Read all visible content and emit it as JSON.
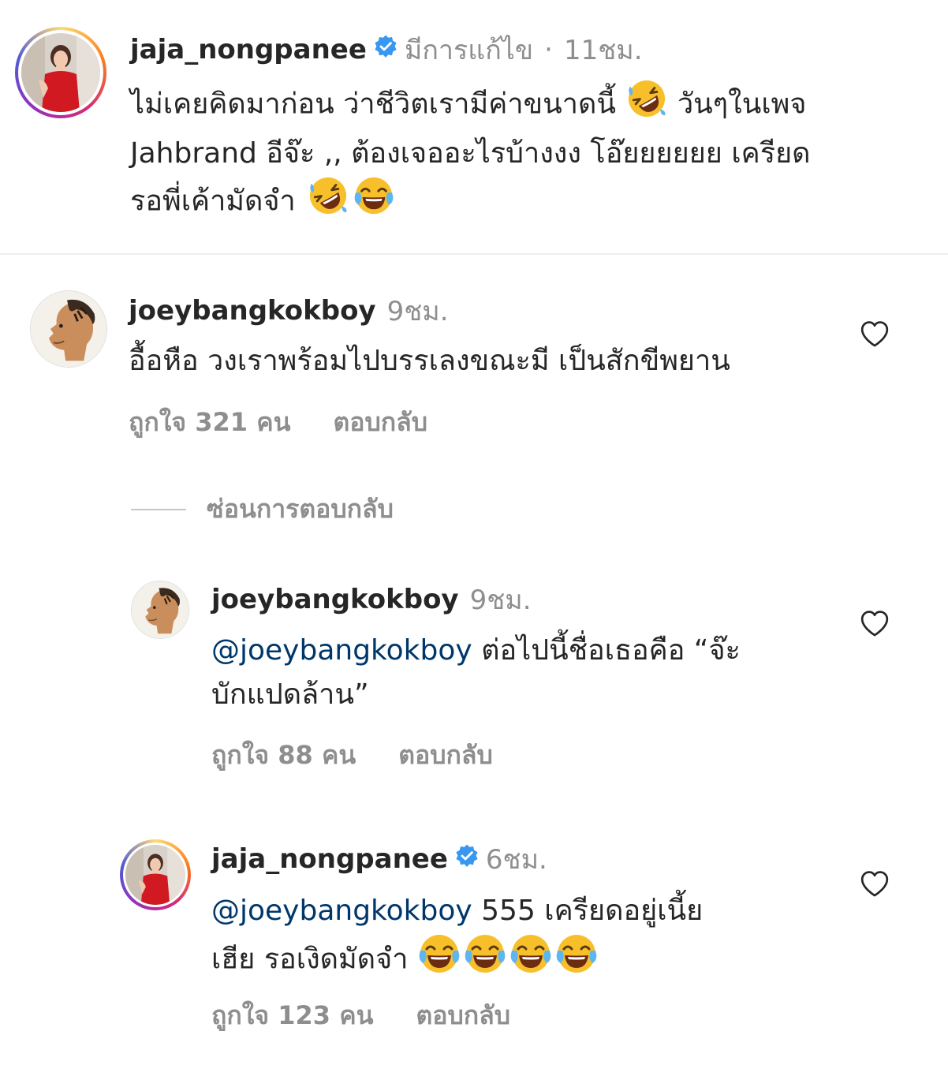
{
  "post_caption": {
    "username": "jaja_nongpanee",
    "verified": true,
    "edited_label": "มีการแก้ไข",
    "separator": "·",
    "time": "11ชม.",
    "text_line1": "ไม่เคยคิดมาก่อน ว่าชีวิตเรามีค่าขนาดนี้",
    "text_line1b": "วันๆในเพจ",
    "text_line2": "Jahbrand อีจ๊ะ ,, ต้องเจออะไรบ้างงง โอ๊ยยยยยย เครียด",
    "text_line3": "รอพี่เค้ามัดจำ",
    "avatar_icon": "profile-photo-woman-red-dress"
  },
  "comments": [
    {
      "username": "joeybangkokboy",
      "time": "9ชม.",
      "text": "อื้อหือ วงเราพร้อมไปบรรเลงขณะมี เป็นสักขีพยาน",
      "likes_label": "ถูกใจ 321 คน",
      "reply_label": "ตอบกลับ",
      "avatar_icon": "profile-photo-man-profile"
    }
  ],
  "hide_replies_label": "ซ่อนการตอบกลับ",
  "replies": [
    {
      "username": "joeybangkokboy",
      "time": "9ชม.",
      "mention": "@joeybangkokboy",
      "text_line1": "ต่อไปนี้ชื่อเธอคือ “จ๊ะ",
      "text_line2": "บักแปดล้าน”",
      "likes_label": "ถูกใจ 88 คน",
      "reply_label": "ตอบกลับ"
    },
    {
      "username": "jaja_nongpanee",
      "verified": true,
      "time": "6ชม.",
      "mention": "@joeybangkokboy",
      "text_line1": "555 เครียดอยู่เนี้ย",
      "text_line2": "เฮีย รอเงิดมัดจำ",
      "likes_label": "ถูกใจ 123 คน",
      "reply_label": "ตอบกลับ"
    }
  ],
  "colors": {
    "text": "#262626",
    "secondary": "#8e8e8e",
    "mention": "#00376b",
    "verified": "#3897f0",
    "divider": "#efefef"
  },
  "icons": [
    "verified-badge-icon",
    "heart-icon",
    "rofl-emoji-icon",
    "joy-emoji-icon"
  ]
}
